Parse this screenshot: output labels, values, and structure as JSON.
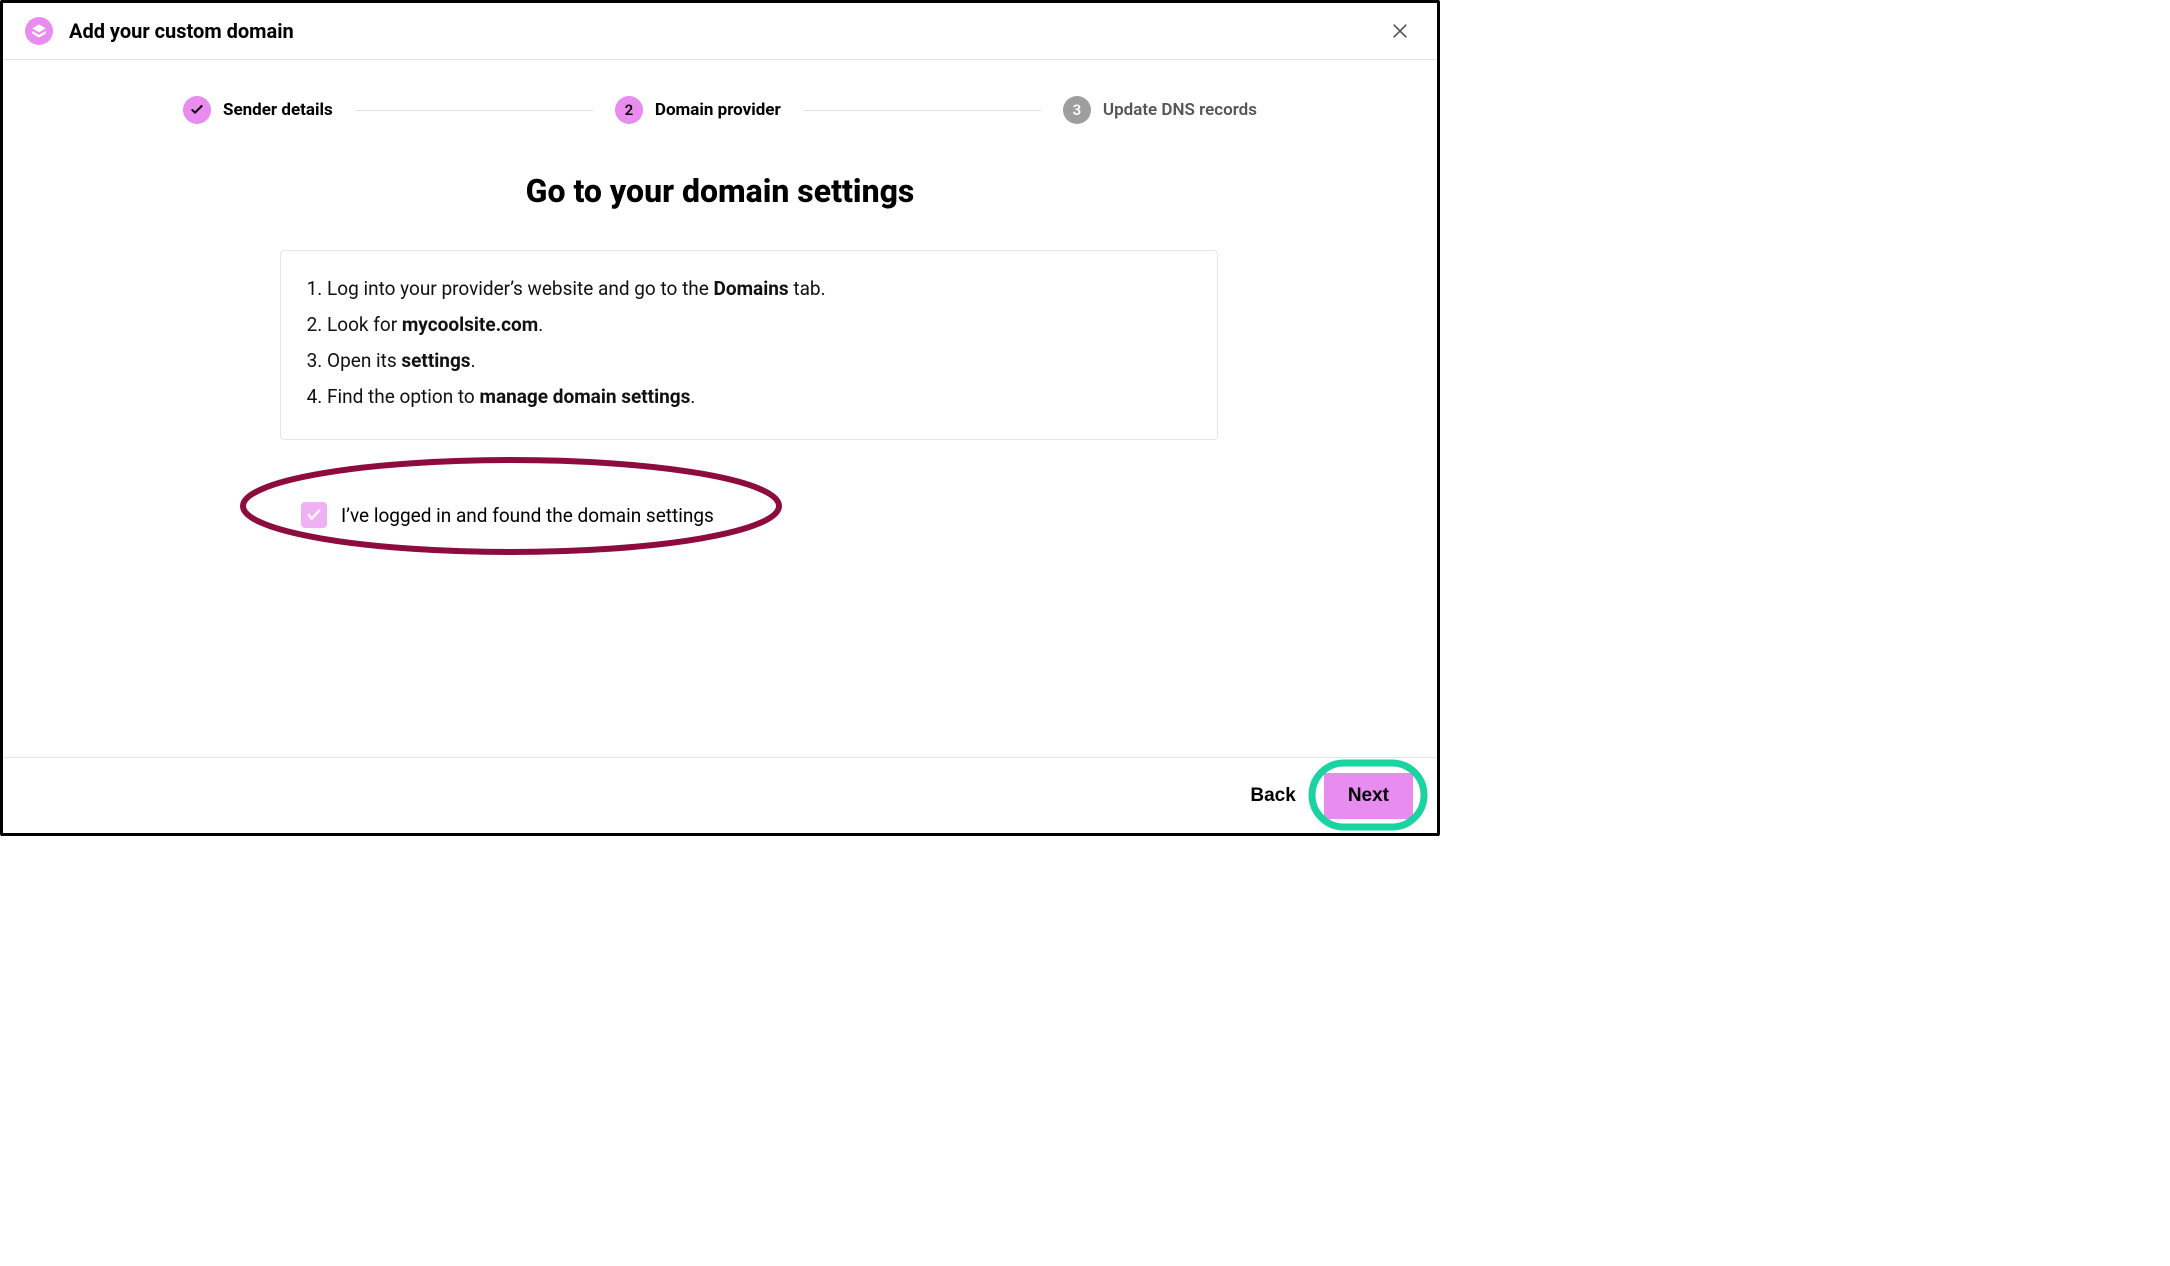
{
  "header": {
    "title": "Add your custom domain"
  },
  "steps": [
    {
      "label": "Sender details",
      "state": "done",
      "badge": "✓"
    },
    {
      "label": "Domain provider",
      "state": "active",
      "badge": "2"
    },
    {
      "label": "Update DNS records",
      "state": "pending",
      "badge": "3"
    }
  ],
  "main": {
    "title": "Go to your domain settings",
    "instructions": [
      {
        "pre": "Log into your provider’s website and go to the ",
        "bold": "Domains",
        "post": " tab."
      },
      {
        "pre": "Look for ",
        "bold": "mycoolsite.com",
        "post": "."
      },
      {
        "pre": "Open its ",
        "bold": "settings",
        "post": "."
      },
      {
        "pre": "Find the option to ",
        "bold": "manage domain settings",
        "post": "."
      }
    ],
    "confirm": {
      "checked": true,
      "label": "I’ve logged in and found the domain settings"
    }
  },
  "footer": {
    "back": "Back",
    "next": "Next"
  },
  "annotations": {
    "ellipse_color": "#8e0b3d",
    "next_ring_color": "#19d3a2"
  }
}
